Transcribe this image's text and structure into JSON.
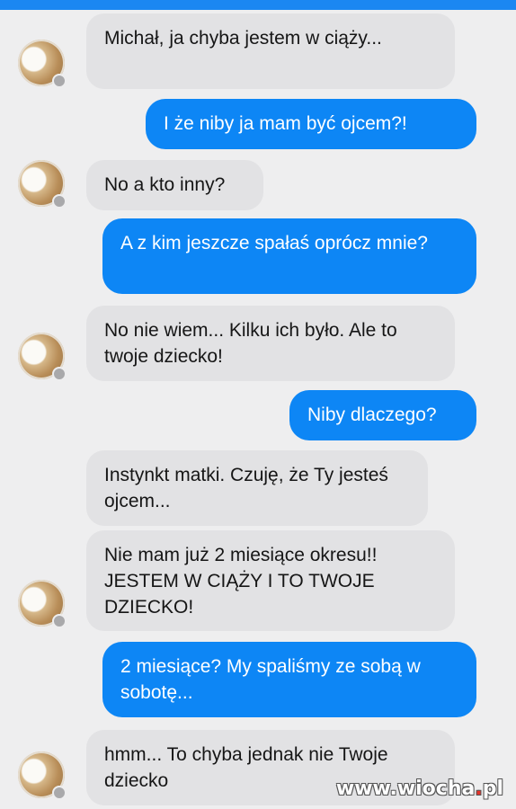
{
  "messages": [
    {
      "side": "in",
      "text": "Michał, ja chyba jestem w ciąży..."
    },
    {
      "side": "out",
      "text": "I że niby ja mam być ojcem?!"
    },
    {
      "side": "in",
      "text": "No a kto inny?"
    },
    {
      "side": "out",
      "text": "A z kim jeszcze spałaś oprócz mnie?"
    },
    {
      "side": "in",
      "text": "No nie wiem... Kilku ich było. Ale to twoje dziecko!"
    },
    {
      "side": "out",
      "text": "Niby dlaczego?"
    },
    {
      "side": "in",
      "text": "Instynkt matki. Czuję, że Ty jesteś ojcem..."
    },
    {
      "side": "in",
      "text": "Nie mam już 2 miesiące okresu!! JESTEM W CIĄŻY I TO TWOJE DZIECKO!"
    },
    {
      "side": "out",
      "text": "2 miesiące? My spaliśmy ze sobą w sobotę..."
    },
    {
      "side": "in",
      "text": "hmm... To chyba jednak nie Twoje dziecko"
    }
  ],
  "watermark": {
    "main": "www.wiocha",
    "dot": ".",
    "tld": "pl"
  },
  "colors": {
    "outgoing": "#0d86f5",
    "incoming": "#e2e2e4",
    "accent_bar": "#1b87f2"
  }
}
